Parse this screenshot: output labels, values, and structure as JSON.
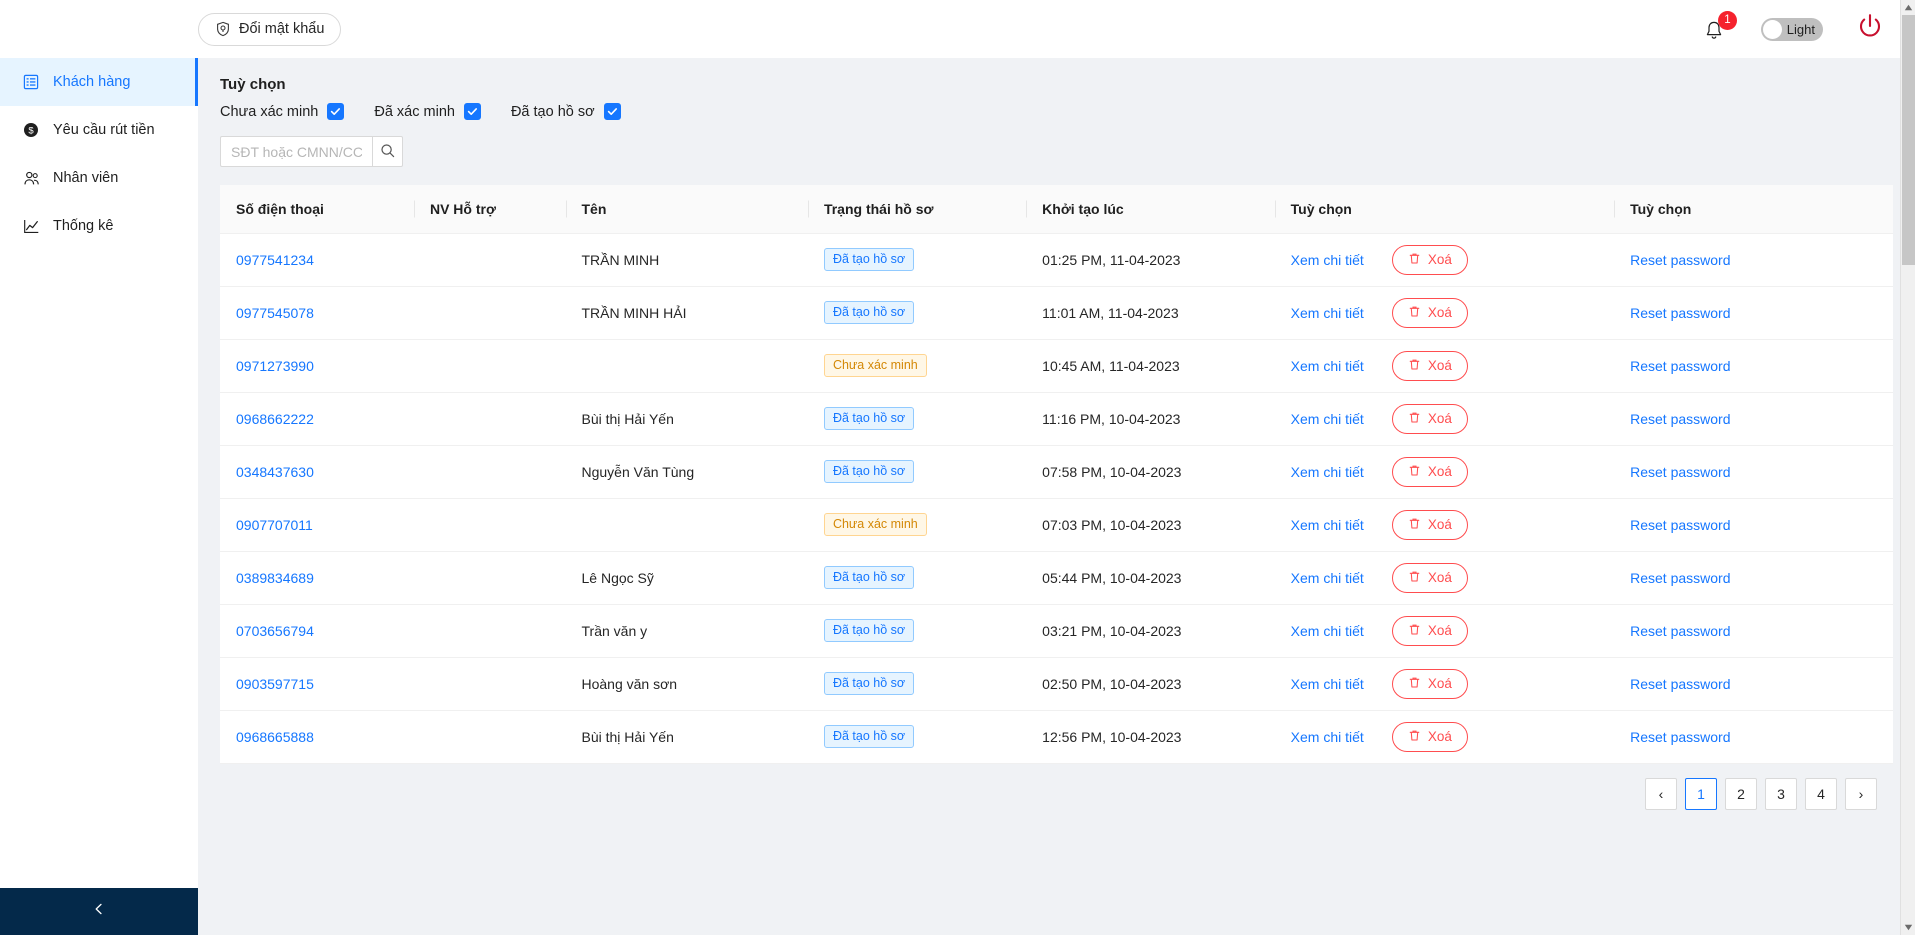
{
  "topbar": {
    "change_password_label": "Đổi mật khẩu",
    "change_password_icon": "shield-lock-icon",
    "notification_count": "1",
    "notification_icon": "bell-icon",
    "theme_toggle_label": "Light",
    "power_icon": "power-icon"
  },
  "sidebar": {
    "items": [
      {
        "label": "Khách hàng",
        "icon": "list-card-icon",
        "active": true
      },
      {
        "label": "Yêu cầu rút tiền",
        "icon": "dollar-circle-icon",
        "active": false
      },
      {
        "label": "Nhân viên",
        "icon": "users-icon",
        "active": false
      },
      {
        "label": "Thống kê",
        "icon": "chart-line-icon",
        "active": false
      }
    ],
    "collapse_icon": "chevron-left-icon"
  },
  "filters": {
    "title": "Tuỳ chọn",
    "checkboxes": [
      {
        "label": "Chưa xác minh",
        "checked": true
      },
      {
        "label": "Đã xác minh",
        "checked": true
      },
      {
        "label": "Đã tạo hồ sơ",
        "checked": true
      }
    ],
    "search": {
      "placeholder": "SĐT hoặc CMNN/CCCD",
      "value": "",
      "button_icon": "search-icon"
    }
  },
  "table": {
    "columns": [
      "Số điện thoại",
      "NV Hỗ trợ",
      "Tên",
      "Trạng thái hồ sơ",
      "Khởi tạo lúc",
      "Tuỳ chọn",
      "Tuỳ chọn"
    ],
    "actions": {
      "detail_label": "Xem chi tiết",
      "delete_label": "Xoá",
      "delete_icon": "trash-icon",
      "reset_label": "Reset password"
    },
    "rows": [
      {
        "phone": "0977541234",
        "staff": "",
        "name": "TRẦN MINH",
        "status": "Đã tạo hồ sơ",
        "status_type": "blue",
        "created": "01:25 PM, 11-04-2023"
      },
      {
        "phone": "0977545078",
        "staff": "",
        "name": "TRẦN MINH HẢI",
        "status": "Đã tạo hồ sơ",
        "status_type": "blue",
        "created": "11:01 AM, 11-04-2023"
      },
      {
        "phone": "0971273990",
        "staff": "",
        "name": "",
        "status": "Chưa xác minh",
        "status_type": "orange",
        "created": "10:45 AM, 11-04-2023"
      },
      {
        "phone": "0968662222",
        "staff": "",
        "name": "Bùi thị Hải Yến",
        "status": "Đã tạo hồ sơ",
        "status_type": "blue",
        "created": "11:16 PM, 10-04-2023"
      },
      {
        "phone": "0348437630",
        "staff": "",
        "name": "Nguyễn Văn Tùng",
        "status": "Đã tạo hồ sơ",
        "status_type": "blue",
        "created": "07:58 PM, 10-04-2023"
      },
      {
        "phone": "0907707011",
        "staff": "",
        "name": "",
        "status": "Chưa xác minh",
        "status_type": "orange",
        "created": "07:03 PM, 10-04-2023"
      },
      {
        "phone": "0389834689",
        "staff": "",
        "name": "Lê Ngọc Sỹ",
        "status": "Đã tạo hồ sơ",
        "status_type": "blue",
        "created": "05:44 PM, 10-04-2023"
      },
      {
        "phone": "0703656794",
        "staff": "",
        "name": "Trần văn y",
        "status": "Đã tạo hồ sơ",
        "status_type": "blue",
        "created": "03:21 PM, 10-04-2023"
      },
      {
        "phone": "0903597715",
        "staff": "",
        "name": "Hoàng văn sơn",
        "status": "Đã tạo hồ sơ",
        "status_type": "blue",
        "created": "02:50 PM, 10-04-2023"
      },
      {
        "phone": "0968665888",
        "staff": "",
        "name": "Bùi thị Hải Yến",
        "status": "Đã tạo hồ sơ",
        "status_type": "blue",
        "created": "12:56 PM, 10-04-2023"
      }
    ]
  },
  "pagination": {
    "items": [
      {
        "label": "‹",
        "current": false
      },
      {
        "label": "1",
        "current": true
      },
      {
        "label": "2",
        "current": false
      },
      {
        "label": "3",
        "current": false
      },
      {
        "label": "4",
        "current": false
      },
      {
        "label": "›",
        "current": false
      }
    ]
  },
  "colors": {
    "accent": "#1677ff",
    "danger": "#ff4d4f",
    "warning": "#d48806",
    "sidebar_footer": "#04294a",
    "page_bg": "#f0f2f5"
  }
}
